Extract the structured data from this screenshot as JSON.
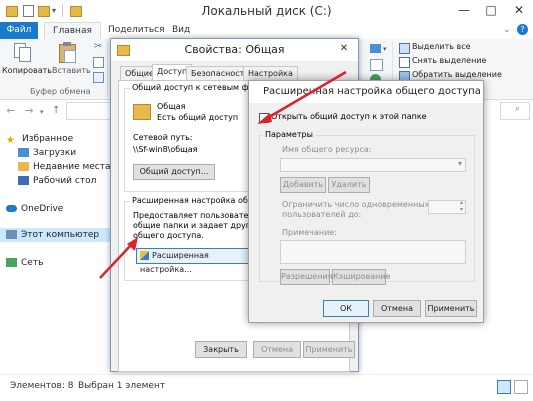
{
  "window": {
    "title": "Локальный диск (C:)",
    "minimize_glyph": "—",
    "maximize_glyph": "□",
    "close_glyph": "✕"
  },
  "ribbon_tabs": [
    "Файл",
    "Главная",
    "Поделиться",
    "Вид"
  ],
  "ribbon": {
    "copy_label": "Копировать",
    "paste_label": "Вставить",
    "clipboard_group": "Буфер обмена",
    "select_all": "Выделить все",
    "select_none": "Снять выделение",
    "invert_selection": "Обратить выделение"
  },
  "nav": {
    "back_glyph": "←",
    "forward_glyph": "→",
    "favorites": "Избранное",
    "downloads": "Загрузки",
    "recent": "Недавние места",
    "desktop": "Рабочий стол",
    "onedrive": "OneDrive",
    "this_pc": "Этот компьютер",
    "network": "Сеть"
  },
  "status": {
    "items_count": "Элементов: 8",
    "selected": "Выбран 1 элемент"
  },
  "props": {
    "title": "Свойства: Общая",
    "tabs": [
      "Общие",
      "Доступ",
      "Безопасность",
      "Настройка"
    ],
    "sharing_group": "Общий доступ к сетевым файлам",
    "folder_name": "Общая",
    "folder_state": "Есть общий доступ",
    "net_path_label": "Сетевой путь:",
    "net_path": "\\\\Sf-win8\\общая",
    "share_button": "Общий доступ...",
    "advanced_group": "Расширенная настройка общего д",
    "advanced_desc": [
      "Предоставляет пользовательск",
      "общие папки и задает другие",
      "общего доступа."
    ],
    "advanced_button": "Расширенная настройка...",
    "close_button": "Закрыть",
    "cancel_button": "Отмена",
    "apply_button": "Применить"
  },
  "adv": {
    "title": "Расширенная настройка общего доступа",
    "share_checkbox": "Открыть общий доступ к этой папке",
    "params_group": "Параметры",
    "share_name_label": "Имя общего ресурса:",
    "add_button": "Добавить",
    "delete_button": "Удалить",
    "limit_label": [
      "Ограничить число одновременных",
      "пользователей до:"
    ],
    "note_label": "Примечание:",
    "permissions_button": "Разрешения",
    "caching_button": "Кэширование",
    "ok_button": "ОК",
    "cancel_button": "Отмена",
    "apply_button": "Применить"
  },
  "colors": {
    "accent": "#1979ca",
    "annotation_arrow": "#d9232d"
  }
}
